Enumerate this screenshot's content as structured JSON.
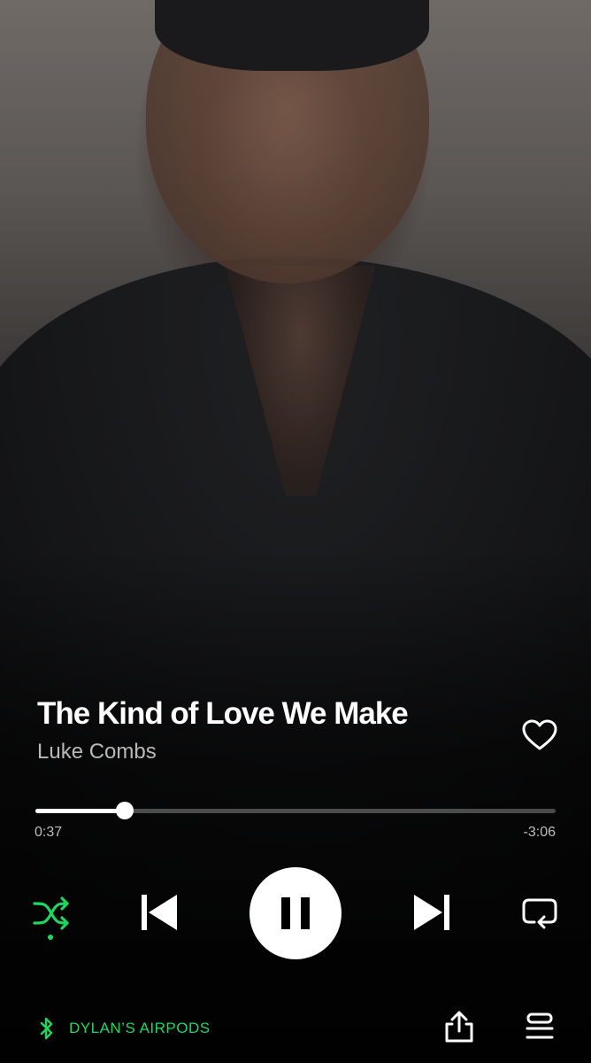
{
  "track": {
    "title": "The Kind of Love We Make",
    "artist": "Luke Combs",
    "liked": false
  },
  "progress": {
    "elapsed": "0:37",
    "remaining": "-3:06",
    "fraction": 0.172
  },
  "controls": {
    "shuffle_enabled": true,
    "is_playing": true,
    "repeat_mode": "off"
  },
  "device": {
    "name": "DYLAN’S AIRPODS",
    "icon": "bluetooth-icon"
  },
  "icons": {
    "like": "heart-outline-icon",
    "shuffle": "shuffle-icon",
    "previous": "skip-previous-icon",
    "pause": "pause-icon",
    "next": "skip-next-icon",
    "repeat": "repeat-icon",
    "share": "share-icon",
    "queue": "queue-icon"
  },
  "colors": {
    "accent": "#1ed760",
    "text_primary": "#ffffff",
    "text_secondary": "#b9b9b9",
    "background": "#000000"
  }
}
